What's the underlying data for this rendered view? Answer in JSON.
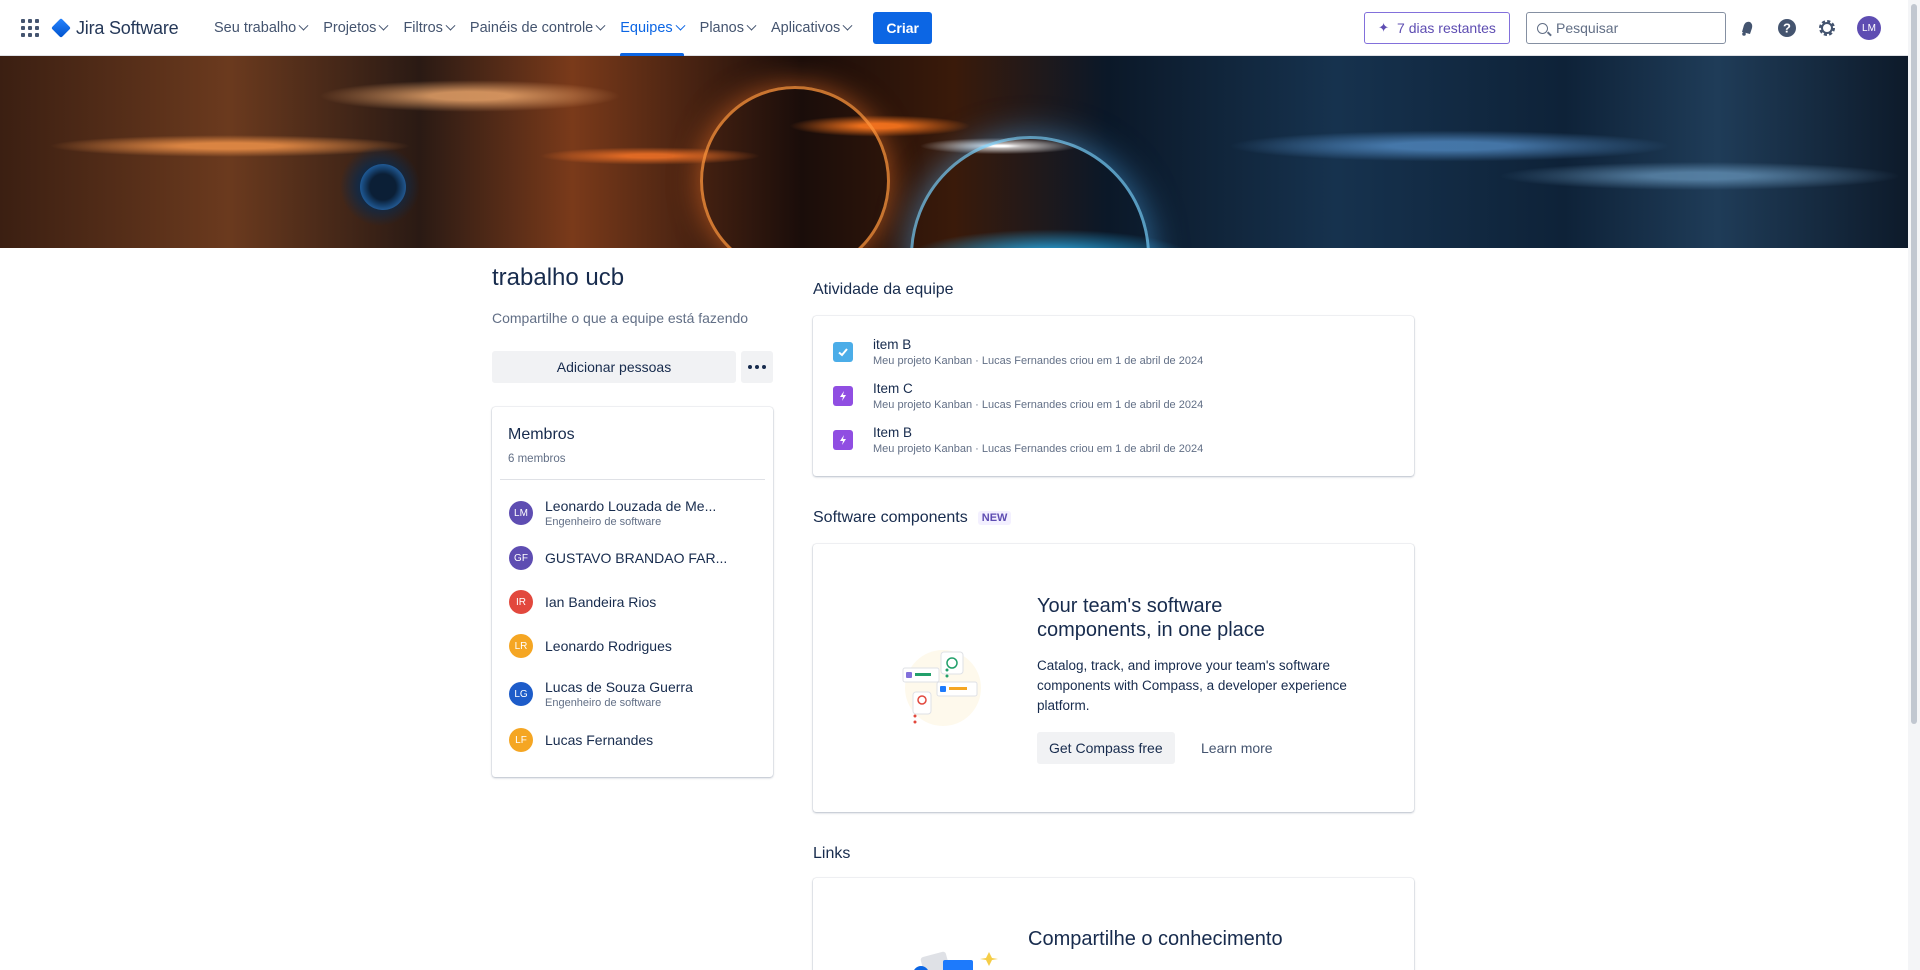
{
  "nav": {
    "product_name": "Jira Software",
    "menu": [
      {
        "label": "Seu trabalho"
      },
      {
        "label": "Projetos"
      },
      {
        "label": "Filtros"
      },
      {
        "label": "Painéis de controle"
      },
      {
        "label": "Equipes",
        "active": true
      },
      {
        "label": "Planos"
      },
      {
        "label": "Aplicativos"
      }
    ],
    "create_label": "Criar",
    "trial_label": "7 dias restantes",
    "search_placeholder": "Pesquisar",
    "user_initials": "LM",
    "accent_color": "#0c66e4"
  },
  "team": {
    "name": "trabalho ucb",
    "description": "Compartilhe o que a equipe está fazendo",
    "add_people_label": "Adicionar pessoas"
  },
  "members": {
    "title": "Membros",
    "count_label": "6 membros",
    "items": [
      {
        "initials": "LM",
        "name": "Leonardo Louzada de Me...",
        "role": "Engenheiro de software",
        "color": "#5e4db2"
      },
      {
        "initials": "GF",
        "name": "GUSTAVO BRANDAO FAR...",
        "role": "",
        "color": "#5e4db2"
      },
      {
        "initials": "IR",
        "name": "Ian Bandeira Rios",
        "role": "",
        "color": "#e2483d"
      },
      {
        "initials": "LR",
        "name": "Leonardo Rodrigues",
        "role": "",
        "color": "#f5a623"
      },
      {
        "initials": "LG",
        "name": "Lucas de Souza Guerra",
        "role": "Engenheiro de software",
        "color": "#1d5cc9"
      },
      {
        "initials": "LF",
        "name": "Lucas Fernandes",
        "role": "",
        "color": "#f5a623"
      }
    ]
  },
  "activity": {
    "title": "Atividade da equipe",
    "items": [
      {
        "icon": "task-checkbox-icon",
        "title": "item B",
        "meta": "Meu projeto Kanban · Lucas Fernandes criou em 1 de abril de 2024"
      },
      {
        "icon": "epic-lightning-icon",
        "title": "Item C",
        "meta": "Meu projeto Kanban · Lucas Fernandes criou em 1 de abril de 2024"
      },
      {
        "icon": "epic-lightning-icon",
        "title": "Item B",
        "meta": "Meu projeto Kanban · Lucas Fernandes criou em 1 de abril de 2024"
      }
    ]
  },
  "components": {
    "title": "Software components",
    "badge": "NEW",
    "heading": "Your team's software components, in one place",
    "body": "Catalog, track, and improve your team's software components with Compass, a developer experience platform.",
    "primary_label": "Get Compass free",
    "secondary_label": "Learn more"
  },
  "links": {
    "title": "Links",
    "heading": "Compartilhe o conhecimento"
  }
}
